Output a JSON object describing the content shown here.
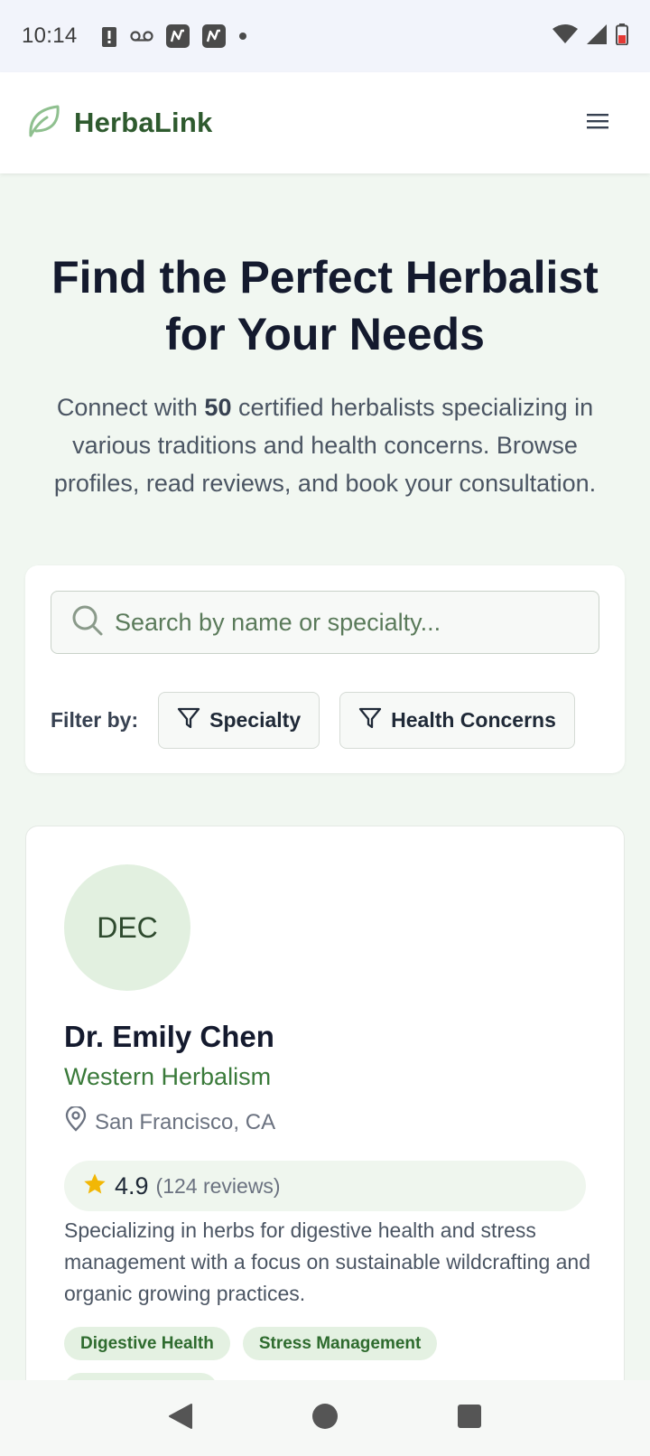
{
  "status_bar": {
    "time": "10:14",
    "icons": [
      "alert-icon",
      "voicemail-icon",
      "app-notification-icon",
      "app-notification-icon",
      "dot-icon",
      "wifi-icon",
      "signal-icon",
      "battery-icon"
    ]
  },
  "header": {
    "brand_name": "HerbaLink",
    "logo_icon": "leaf-icon",
    "menu_icon": "hamburger-menu-icon"
  },
  "hero": {
    "title": "Find the Perfect Herbalist for Your Needs",
    "subtitle_prefix": "Connect with ",
    "herbalist_count": "50",
    "subtitle_suffix": " certified herbalists specializing in various traditions and health concerns. Browse profiles, read reviews, and book your consultation."
  },
  "search": {
    "placeholder": "Search by name or specialty...",
    "value": "",
    "filter_label": "Filter by:",
    "filters": [
      "Specialty",
      "Health Concerns"
    ]
  },
  "herbalists": [
    {
      "initials": "DEC",
      "name": "Dr. Emily Chen",
      "specialty": "Western Herbalism",
      "location": "San Francisco, CA",
      "rating": "4.9",
      "reviews": "(124 reviews)",
      "description": "Specializing in herbs for digestive health and stress management with a focus on sustainable wildcrafting and organic growing practices.",
      "tags": [
        "Digestive Health",
        "Stress Management"
      ]
    }
  ],
  "colors": {
    "brand_green": "#2e5a2e",
    "accent_green": "#3a7a3a",
    "page_bg": "#f1f7f1",
    "star": "#f2b705"
  }
}
